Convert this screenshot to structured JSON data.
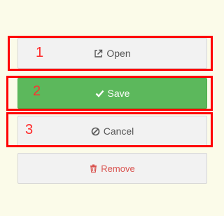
{
  "buttons": {
    "open_label": "Open",
    "save_label": "Save",
    "cancel_label": "Cancel",
    "remove_label": "Remove"
  },
  "annotations": {
    "labels": [
      "1",
      "2",
      "3"
    ],
    "highlight_color": "#ff0000"
  },
  "colors": {
    "save_bg": "#5cb85c",
    "remove_text": "#d9534f",
    "button_bg": "#f2f2f2",
    "page_bg": "#fbfbe9"
  },
  "icons": {
    "open": "external-link-icon",
    "save": "check-icon",
    "cancel": "ban-icon",
    "remove": "trash-icon"
  }
}
